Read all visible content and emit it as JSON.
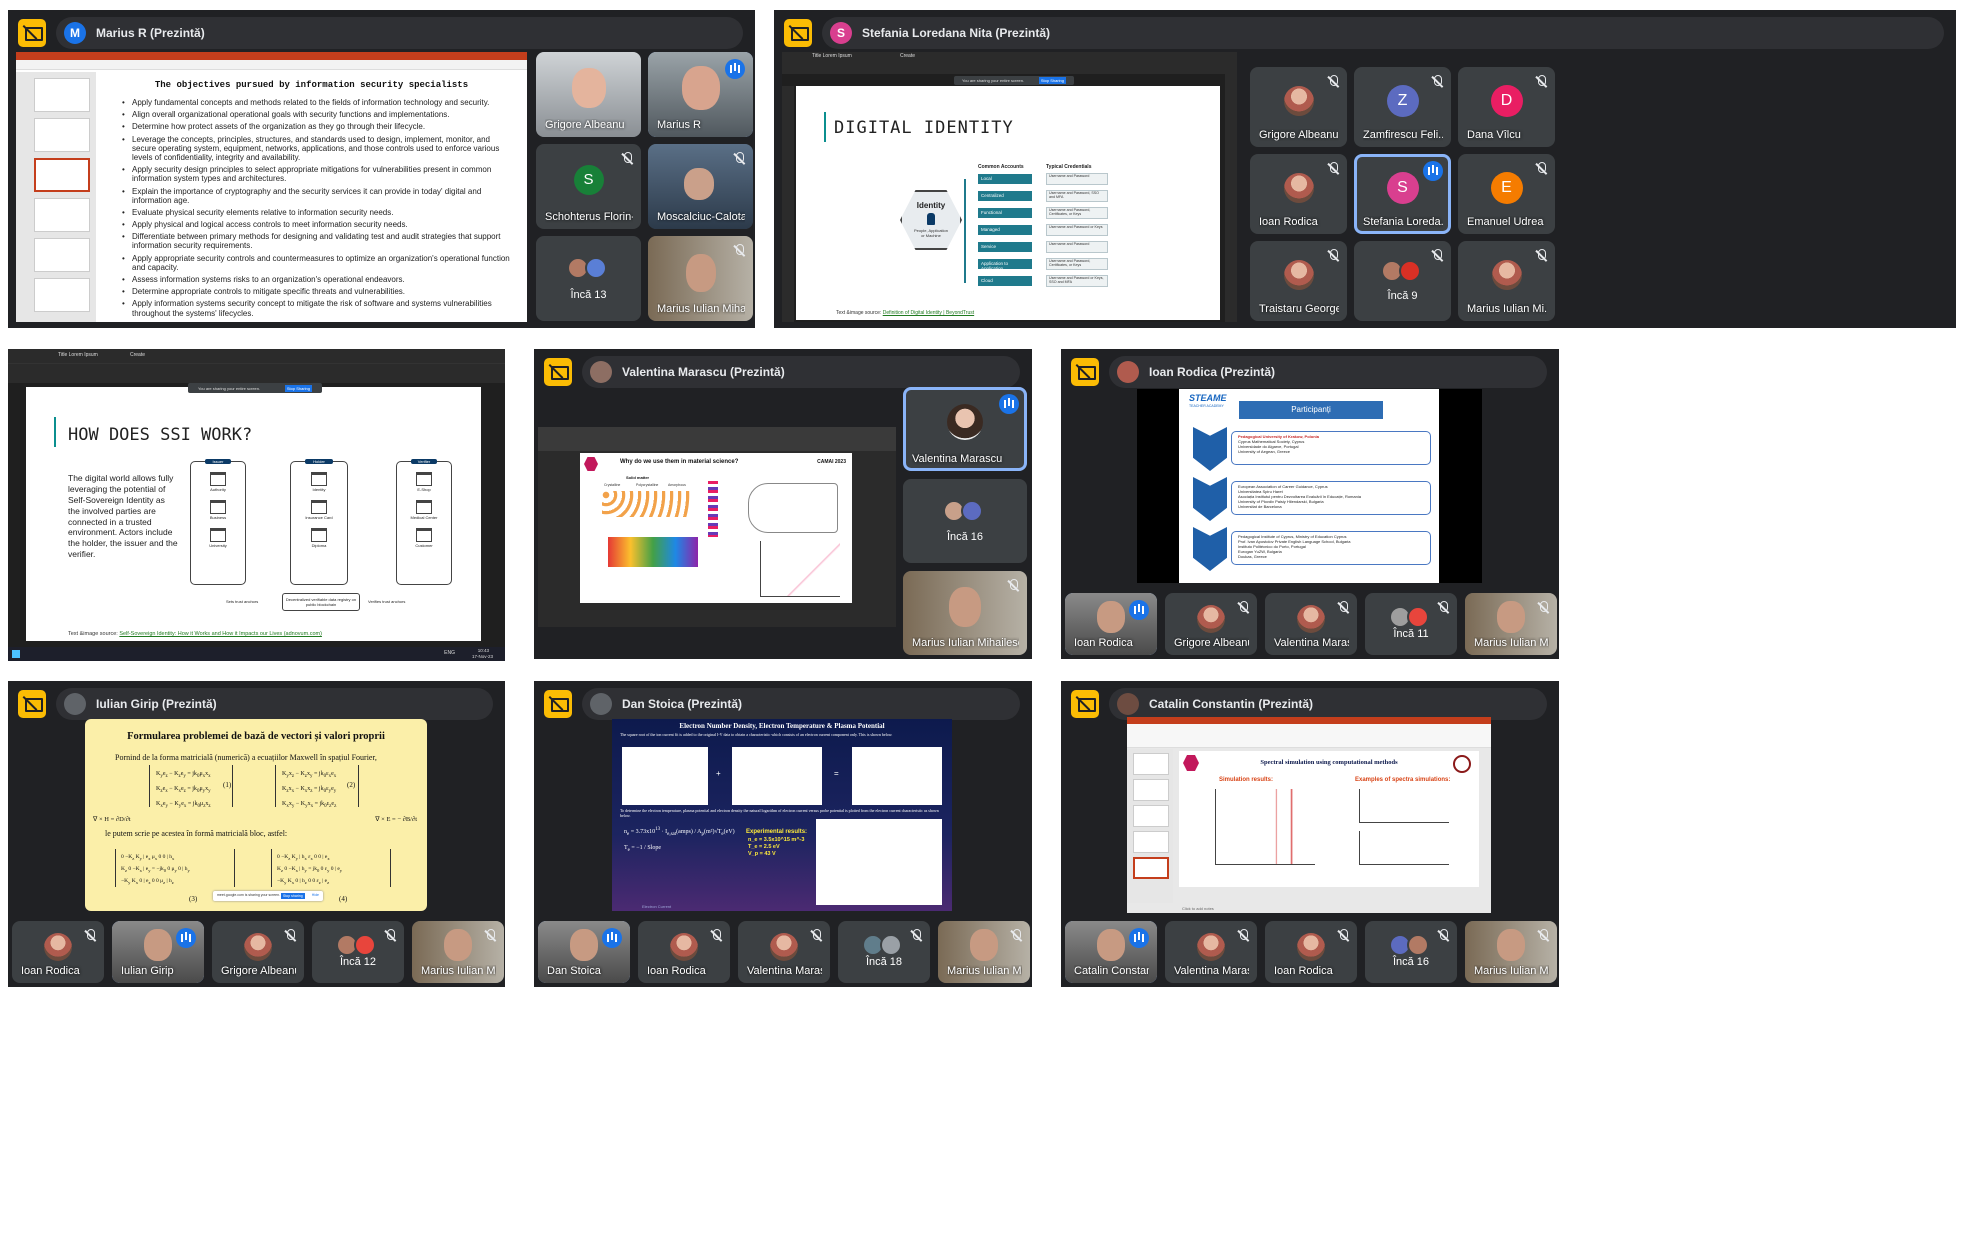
{
  "panels": [
    {
      "presenter": "Marius R (Prezintă)",
      "avatar_letter": "M",
      "avatar_color": "#1a73e8",
      "slide_title": "The objectives pursued by information security specialists",
      "slide_bullets": [
        "Apply fundamental concepts and methods related to the fields of information technology and security.",
        "Align overall organizational operational goals with security functions and implementations.",
        "Determine how protect assets of the organization as they go through their lifecycle.",
        "Leverage the concepts, principles, structures, and standards used to design, implement, monitor, and secure operating system, equipment, networks, applications, and those controls used to enforce various levels of confidentiality, integrity and availability.",
        "Apply security design principles to select appropriate mitigations for vulnerabilities present in common information system types and architectures.",
        "Explain the importance of cryptography and the security services it can provide in today' digital and information age.",
        "Evaluate physical security elements relative to information security needs.",
        "Apply physical and logical access controls to meet information security needs.",
        "Differentiate between primary methods for designing and validating test and audit strategies that support information security requirements.",
        "Apply appropriate security controls and countermeasures to optimize an organization's operational function and capacity.",
        "Assess information systems risks to an organization's operational endeavors.",
        "Determine appropriate controls to mitigate specific threats and vulnerabilities.",
        "Apply information systems security concept to mitigate the risk of software and systems vulnerabilities throughout the systems' lifecycles."
      ],
      "tiles": [
        {
          "name": "Grigore Albeanu"
        },
        {
          "name": "Marius R"
        },
        {
          "name": "Schohterus Florin-...",
          "letter": "S"
        },
        {
          "name": "Moscalciuc-Calota ..."
        },
        {
          "name": "Încă 13"
        },
        {
          "name": "Marius Iulian Mihail..."
        }
      ]
    },
    {
      "presenter": "Stefania Loredana Nita (Prezintă)",
      "avatar_letter": "S",
      "avatar_color": "#d93f8f",
      "slide_title": "DIGITAL IDENTITY",
      "center_label": "Identity",
      "center_sub": "People, Application or Machine",
      "col1": "Common Accounts",
      "col2": "Typical Credentials",
      "rows": [
        "Local",
        "Centralized",
        "Functional",
        "Managed",
        "Service",
        "Application to Application",
        "Cloud"
      ],
      "creds": [
        "Username and Password",
        "Username and Password, SSO and MFA",
        "Username and Password, Certificates, or Keys",
        "Username and Password or Keys",
        "Username and Password",
        "Username and Password, Certificates, or Keys",
        "Username and Password or Keys, SSO and MFA"
      ],
      "source_prefix": "Text &image source:",
      "source_link": "Definition of Digital Identity | BeyondTrust",
      "sharing_text": "You are sharing your entire screen.",
      "stop_sharing": "Stop Sharing",
      "tab_title": "Title Lorem Ipsum",
      "tab_create": "Create",
      "tiles": [
        {
          "name": "Grigore Albeanu"
        },
        {
          "name": "Zamfirescu Feli...",
          "letter": "Z",
          "color": "#5c6bc0"
        },
        {
          "name": "Dana Vîlcu",
          "letter": "D",
          "color": "#e91e63"
        },
        {
          "name": "Ioan Rodica"
        },
        {
          "name": "Stefania Loreda...",
          "letter": "S",
          "color": "#d93f8f"
        },
        {
          "name": "Emanuel Udrea",
          "letter": "E",
          "color": "#f57c00"
        },
        {
          "name": "Traistaru George"
        },
        {
          "name": "Încă 9"
        },
        {
          "name": "Marius Iulian Mi..."
        }
      ]
    },
    {
      "slide_title": "HOW DOES SSI WORK?",
      "body_text": "The digital world allows fully leveraging the potential of Self-Sovereign Identity as the involved parties are connected in a trusted environment. Actors include the holder, the issuer and the verifier.",
      "col_issuer": "Issuer",
      "col_holder": "Holder",
      "col_verifier": "Verifier",
      "issuer_items": [
        "Authority",
        "Business",
        "University"
      ],
      "holder_items": [
        "Identity",
        "Insurance Card",
        "Diploma"
      ],
      "verifier_items": [
        "E-Shop",
        "Medical Center",
        "Customer"
      ],
      "bottom_mid": "Decentralized verifiable data registry on public blockchain",
      "bottom_left": "Sets trust anchors",
      "bottom_right": "Verifies trust anchors",
      "source_prefix": "Text &image source:",
      "source_link": "Self-Sovereign Identity: How it Works and How it Impacts our Lives (adnovum.com)",
      "tab_title": "Title Lorem Ipsum",
      "tab_create": "Create",
      "sharing_text": "You are sharing your entire screen.",
      "stop_sharing": "Stop Sharing",
      "clock": "10:43",
      "date": "17-Nov-23",
      "lang": "ENG"
    },
    {
      "presenter": "Valentina Marascu (Prezintă)",
      "slide_title": "Why do we use them in material science?",
      "slide_sub": "Solid matter",
      "labels": [
        "Crystalline",
        "Polycrystalline",
        "Amorphous"
      ],
      "conf": "CAMAI 2023",
      "tiles": [
        {
          "name": "Valentina Marascu"
        },
        {
          "name": "Încă 16"
        },
        {
          "name": "Marius Iulian Mihailescu"
        }
      ]
    },
    {
      "presenter": "Ioan Rodica (Prezintă)",
      "brand": "STEAME",
      "brand_sub": "TEACHER ACADEMY",
      "slide_title": "Participanți",
      "groups": [
        [
          "Pedagogical University of Krakow, Polonia",
          "Cyprus Mathematical Society, Cyprus",
          "Universidade do Algarve, Portugal",
          "University of Aegean, Greece"
        ],
        [
          "European Association of Career Guidance, Cyprus",
          "Universitatea Spiru Haret",
          "Asociația Institutul pentru Dezvoltarea Evaluării în Educație, Romania",
          "University of Plovdiv Paisiy Hilendarski, Bulgaria",
          "Universitat de Barcelona"
        ],
        [
          "Pedagogical Institute of Cyprus, Ministry of Education Cyprus",
          "Prof. Ivan Apostolov Private English Language School, Bulgaria",
          "Instituto Politécnico do Porto, Portugal",
          "Eurogan YuZW, Bulgaria",
          "Doukas, Greece"
        ]
      ],
      "tiles": [
        {
          "name": "Ioan Rodica"
        },
        {
          "name": "Grigore Albeanu"
        },
        {
          "name": "Valentina Marascu"
        },
        {
          "name": "Încă 11"
        },
        {
          "name": "Marius Iulian Mih..."
        }
      ]
    },
    {
      "presenter": "Iulian Girip (Prezintă)",
      "slide_title": "Formularea problemei de bază de vectori și valori proprii",
      "line1": "Pornind de la forma matricială (numerică) a ecuațiilor Maxwell în spațiul Fourier,",
      "line2": "le putem scrie pe acestea în formă matricială bloc, astfel:",
      "eq1": "(1)",
      "eq2": "(2)",
      "eq3": "(3)",
      "eq4": "(4)",
      "sharing_text": "meet.google.com is sharing your screen.",
      "stop_sharing": "Stop sharing",
      "hide": "Hide",
      "tiles": [
        {
          "name": "Ioan Rodica"
        },
        {
          "name": "Iulian Girip"
        },
        {
          "name": "Grigore Albeanu"
        },
        {
          "name": "Încă 12"
        },
        {
          "name": "Marius Iulian Mih..."
        }
      ]
    },
    {
      "presenter": "Dan Stoica (Prezintă)",
      "slide_title": "Electron Number Density, Electron Temperature & Plasma Potential",
      "intro": "The square root of the ion current fit is added to the original I-V data to obtain a characteristic which consists of an electron current component only. This is shown below.",
      "results_title": "Experimental results:",
      "results": [
        "n_e = 3.5x10^15 m^-3",
        "T_e = 2.5 eV",
        "V_p = 43 V"
      ],
      "para": "To determine the electron temperature, plasma potential and electron density the natural logarithm of electron current versus probe potential is plotted from the electron current characteristic as shown below.",
      "footer": "Electron Current",
      "tiles": [
        {
          "name": "Dan Stoica"
        },
        {
          "name": "Ioan Rodica"
        },
        {
          "name": "Valentina Marascu"
        },
        {
          "name": "Încă 18"
        },
        {
          "name": "Marius Iulian Mih..."
        }
      ]
    },
    {
      "presenter": "Catalin Constantin (Prezintă)",
      "slide_title": "Spectral simulation using computational methods",
      "left_head": "Simulation results:",
      "right_head": "Examples of spectra simulations:",
      "notes": "Click to add notes",
      "tiles": [
        {
          "name": "Catalin Constantin"
        },
        {
          "name": "Valentina Marascu"
        },
        {
          "name": "Ioan Rodica"
        },
        {
          "name": "Încă 16"
        },
        {
          "name": "Marius Iulian Mih..."
        }
      ]
    }
  ]
}
